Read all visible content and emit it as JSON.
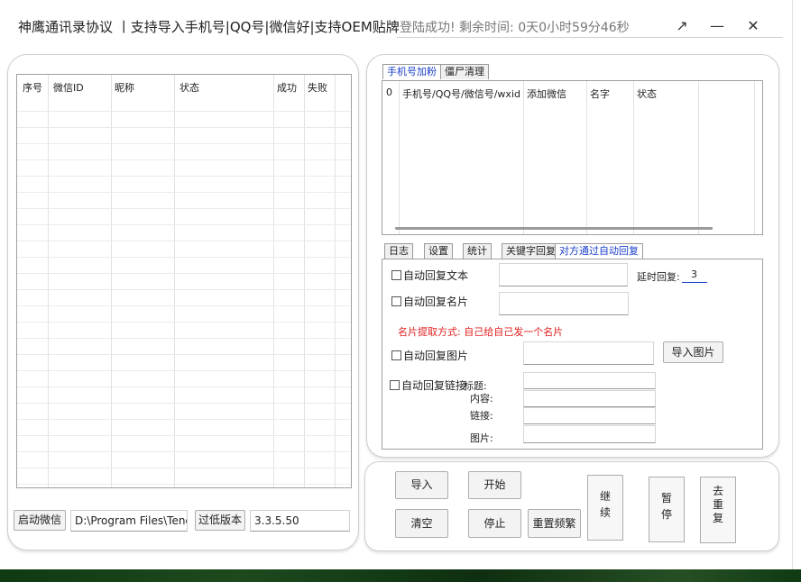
{
  "window": {
    "title": "神鹰通讯录协议 丨支持导入手机号|QQ号|微信好|支持OEM贴牌",
    "status": "登陆成功! 剩余时间: 0天0小时59分46秒",
    "restore_glyph": "↗",
    "minimize_glyph": "—",
    "close_glyph": "✕"
  },
  "left": {
    "columns": [
      "序号",
      "微信ID",
      "昵称",
      "状态",
      "成功",
      "失败"
    ],
    "start_wechat_label": "启动微信",
    "wechat_path": "D:\\Program Files\\Tencent",
    "low_version_label": "过低版本",
    "version_value": "3.3.5.50"
  },
  "right": {
    "top_tabs": [
      "手机号加粉",
      "僵尸清理"
    ],
    "top_columns": [
      "0",
      "手机号/QQ号/微信号/wxid",
      "添加微信",
      "名字",
      "状态"
    ],
    "bottom_tabs": [
      "日志",
      "设置",
      "统计",
      "关键字回复",
      "对方通过自动回复"
    ],
    "auto_reply_text_label": "自动回复文本",
    "delay_label": "延时回复:",
    "delay_value": "3",
    "auto_reply_card_label": "自动回复名片",
    "card_hint": "名片提取方式: 自己给自己发一个名片",
    "auto_reply_image_label": "自动回复图片",
    "import_image_label": "导入图片",
    "auto_reply_link_label": "自动回复链接",
    "link_title_label": "标题:",
    "link_content_label": "内容:",
    "link_url_label": "链接:",
    "link_image_label": "图片:"
  },
  "controls": {
    "import_label": "导入",
    "start_label": "开始",
    "clear_label": "清空",
    "stop_label": "停止",
    "reset_freq_label": "重置频繁",
    "continue_label": "继\n续",
    "pause_label": "暂\n停",
    "dedupe_label": "去\n重\n复"
  },
  "colors": {
    "accent_blue": "#1a3ec9",
    "hint_red": "#e02020"
  }
}
